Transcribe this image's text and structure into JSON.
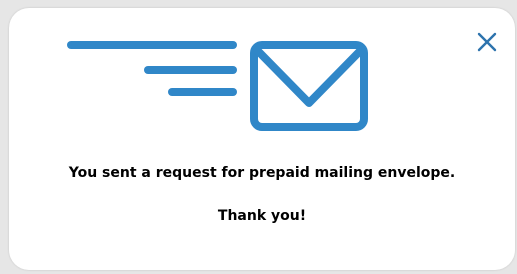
{
  "dialog": {
    "message": "You sent a request for prepaid mailing envelope.",
    "thanks": "Thank you!",
    "close_icon": "close-icon",
    "illustration_icon": "envelope-sent-icon"
  },
  "colors": {
    "accent": "#3087c8",
    "close": "#2d73ad",
    "background": "#ffffff",
    "text": "#000000"
  }
}
